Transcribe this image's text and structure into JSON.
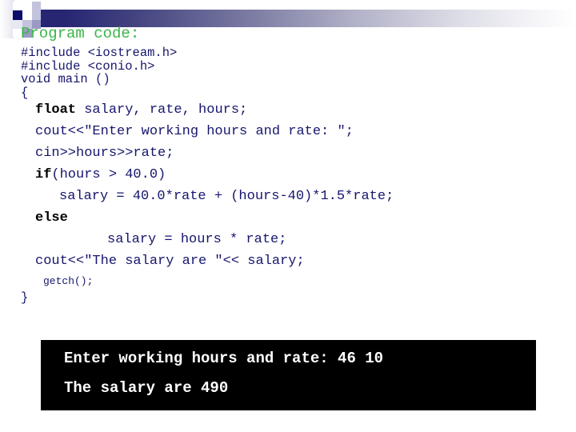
{
  "slide": {
    "title": "Program code:",
    "title_color": "#3cb44a",
    "code_color": "#16166e",
    "header_bar_color": "#262673"
  },
  "code": {
    "lines": [
      {
        "text": "#include <iostream.h>",
        "size": "pre",
        "indent": 0,
        "bold_prefix": ""
      },
      {
        "text": "#include <conio.h>",
        "size": "pre",
        "indent": 0,
        "bold_prefix": ""
      },
      {
        "text": "void main ()",
        "size": "pre",
        "indent": 0,
        "bold_prefix": ""
      },
      {
        "text": "{",
        "size": "pre",
        "indent": 0,
        "bold_prefix": ""
      },
      {
        "text": " salary, rate, hours;",
        "size": "main",
        "indent": 18,
        "bold_prefix": "float"
      },
      {
        "text": "cout<<\"Enter working hours and rate: \";",
        "size": "main",
        "indent": 18,
        "bold_prefix": ""
      },
      {
        "text": "cin>>hours>>rate;",
        "size": "main",
        "indent": 18,
        "bold_prefix": ""
      },
      {
        "text": "(hours > 40.0)",
        "size": "main",
        "indent": 18,
        "bold_prefix": "if"
      },
      {
        "text": "salary = 40.0*rate + (hours-40)*1.5*rate;",
        "size": "main",
        "indent": 48,
        "bold_prefix": ""
      },
      {
        "text": "",
        "size": "main",
        "indent": 18,
        "bold_prefix": "else"
      },
      {
        "text": "salary = hours * rate;",
        "size": "main",
        "indent": 108,
        "bold_prefix": ""
      },
      {
        "text": "cout<<\"The salary are \"<< salary;",
        "size": "main",
        "indent": 18,
        "bold_prefix": ""
      },
      {
        "text": "getch();",
        "size": "small",
        "indent": 28,
        "bold_prefix": ""
      },
      {
        "text": "}",
        "size": "pre",
        "indent": 0,
        "bold_prefix": ""
      }
    ]
  },
  "console": {
    "background": "#000000",
    "text_color": "#ffffff",
    "lines": [
      "Enter working hours and rate: 46 10",
      "The salary are 490"
    ]
  }
}
